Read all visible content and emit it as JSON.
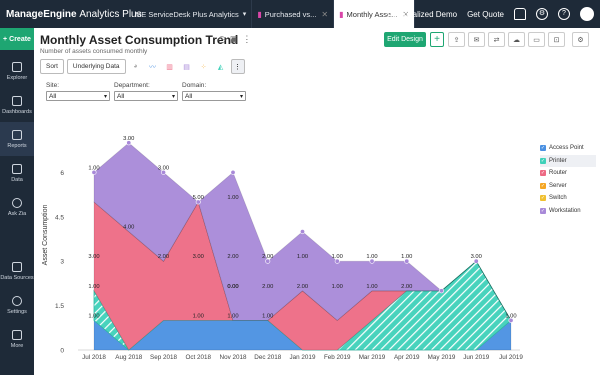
{
  "topbar": {
    "brand": "ManageEngine",
    "brand_suffix": "Analytics Plus",
    "tabs": [
      {
        "label": "ME ServiceDesk Plus Analytics"
      },
      {
        "label": "Purchased vs..."
      },
      {
        "label": "Monthly Asse..."
      }
    ],
    "personalized": "Personalized Demo",
    "get_quote": "Get Quote"
  },
  "sidebar": {
    "create": "Create",
    "items": [
      {
        "label": "Explorer"
      },
      {
        "label": "Dashboards"
      },
      {
        "label": "Reports"
      },
      {
        "label": "Data"
      },
      {
        "label": "Ask Zia"
      },
      {
        "label": "Data Sources"
      },
      {
        "label": "Settings"
      },
      {
        "label": "More"
      }
    ]
  },
  "report": {
    "title": "Monthly Asset Consumption Trend",
    "subtitle": "Number of assets consumed monthly",
    "edit_design": "Edit Design",
    "sort": "Sort",
    "underlying_data": "Underlying Data"
  },
  "filters": [
    {
      "label": "Site:",
      "value": "All"
    },
    {
      "label": "Department:",
      "value": "All"
    },
    {
      "label": "Domain:",
      "value": "All"
    }
  ],
  "colors": {
    "access_point": "#4a90e2",
    "printer": "#3ed1b9",
    "router": "#ed6a84",
    "server": "#f5a623",
    "switch": "#f0c030",
    "workstation": "#a889d8",
    "accent": "#1ea672",
    "nav": "#1e2a38"
  },
  "chart_data": {
    "type": "area",
    "ylabel": "Asset Consumption",
    "ylim": [
      0,
      7.5
    ],
    "yticks": [
      "0",
      "1.5",
      "3",
      "4.5",
      "6"
    ],
    "categories": [
      "Jul 2018",
      "Aug 2018",
      "Sep 2018",
      "Oct 2018",
      "Nov 2018",
      "Dec 2018",
      "Jan 2019",
      "Feb 2019",
      "Mar 2019",
      "Apr 2019",
      "May 2019",
      "Jun 2019",
      "Jul 2019"
    ],
    "series": [
      {
        "name": "Access Point",
        "values": [
          1,
          0,
          1,
          1,
          1,
          1,
          0,
          0,
          0,
          0,
          0,
          0,
          1
        ]
      },
      {
        "name": "Printer",
        "values": [
          1,
          0,
          0,
          0,
          0,
          0,
          0,
          0,
          1,
          2,
          2,
          3,
          0
        ]
      },
      {
        "name": "Router",
        "values": [
          3,
          4,
          2,
          4,
          0,
          0,
          2,
          1,
          1,
          0,
          0,
          0,
          0
        ]
      },
      {
        "name": "Server",
        "values": [
          0,
          0,
          0,
          0,
          0,
          0,
          0,
          0,
          0,
          0,
          0,
          0,
          0
        ]
      },
      {
        "name": "Switch",
        "values": [
          0,
          0,
          0,
          0,
          0,
          0,
          0,
          0,
          0,
          0,
          0,
          0,
          0
        ]
      },
      {
        "name": "Workstation",
        "values": [
          1,
          3,
          3,
          0,
          5,
          2,
          2,
          2,
          1,
          1,
          0,
          0,
          0
        ]
      }
    ],
    "data_labels": [
      {
        "i": 0,
        "y": 1,
        "text": "1.00"
      },
      {
        "i": 0,
        "y": 2,
        "text": "1.00"
      },
      {
        "i": 0,
        "y": 3,
        "text": "3.00"
      },
      {
        "i": 0,
        "y": 6,
        "text": "1.00"
      },
      {
        "i": 1,
        "y": 4,
        "text": "4.00"
      },
      {
        "i": 1,
        "y": 7,
        "text": "3.00"
      },
      {
        "i": 2,
        "y": 3,
        "text": "2.00"
      },
      {
        "i": 2,
        "y": 6,
        "text": "3.00"
      },
      {
        "i": 3,
        "y": 1,
        "text": "1.00"
      },
      {
        "i": 3,
        "y": 3,
        "text": "3.00"
      },
      {
        "i": 3,
        "y": 5,
        "text": "5.00"
      },
      {
        "i": 4,
        "y": 1,
        "text": "1.00"
      },
      {
        "i": 4,
        "y": 2,
        "text": "0.00"
      },
      {
        "i": 4,
        "y": 2,
        "text": "0.00"
      },
      {
        "i": 4,
        "y": 3,
        "text": "2.00"
      },
      {
        "i": 4,
        "y": 5,
        "text": "1.00"
      },
      {
        "i": 5,
        "y": 1,
        "text": "1.00"
      },
      {
        "i": 5,
        "y": 2,
        "text": "2.00"
      },
      {
        "i": 5,
        "y": 3,
        "text": "2.00"
      },
      {
        "i": 6,
        "y": 2,
        "text": "2.00"
      },
      {
        "i": 6,
        "y": 3,
        "text": "1.00"
      },
      {
        "i": 7,
        "y": 2,
        "text": "1.00"
      },
      {
        "i": 7,
        "y": 3,
        "text": "1.00"
      },
      {
        "i": 8,
        "y": 2,
        "text": "1.00"
      },
      {
        "i": 8,
        "y": 3,
        "text": "1.00"
      },
      {
        "i": 9,
        "y": 2,
        "text": "2.00"
      },
      {
        "i": 9,
        "y": 3,
        "text": "1.00"
      },
      {
        "i": 11,
        "y": 3,
        "text": "3.00"
      },
      {
        "i": 12,
        "y": 1,
        "text": "1.00"
      }
    ],
    "legend": [
      "Access Point",
      "Printer",
      "Router",
      "Server",
      "Switch",
      "Workstation"
    ],
    "legend_position": "top-right",
    "grid": false
  }
}
